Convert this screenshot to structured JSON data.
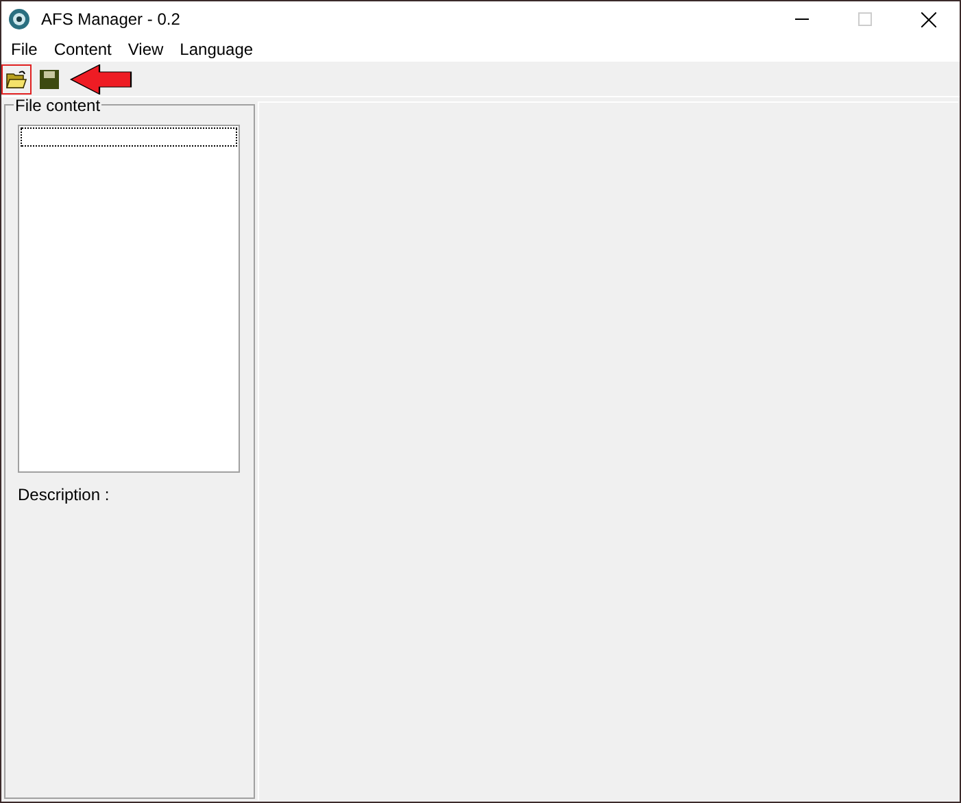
{
  "window": {
    "title": "AFS Manager - 0.2"
  },
  "menu": [
    {
      "label": "File"
    },
    {
      "label": "Content"
    },
    {
      "label": "View"
    },
    {
      "label": "Language"
    }
  ],
  "toolbar": [
    {
      "kind": "open",
      "highlighted": true
    },
    {
      "kind": "save",
      "highlighted": false
    }
  ],
  "file_content": {
    "title": "File content",
    "list_focused": true,
    "description_label": "Description :"
  },
  "annotation": {
    "kind": "arrow"
  }
}
